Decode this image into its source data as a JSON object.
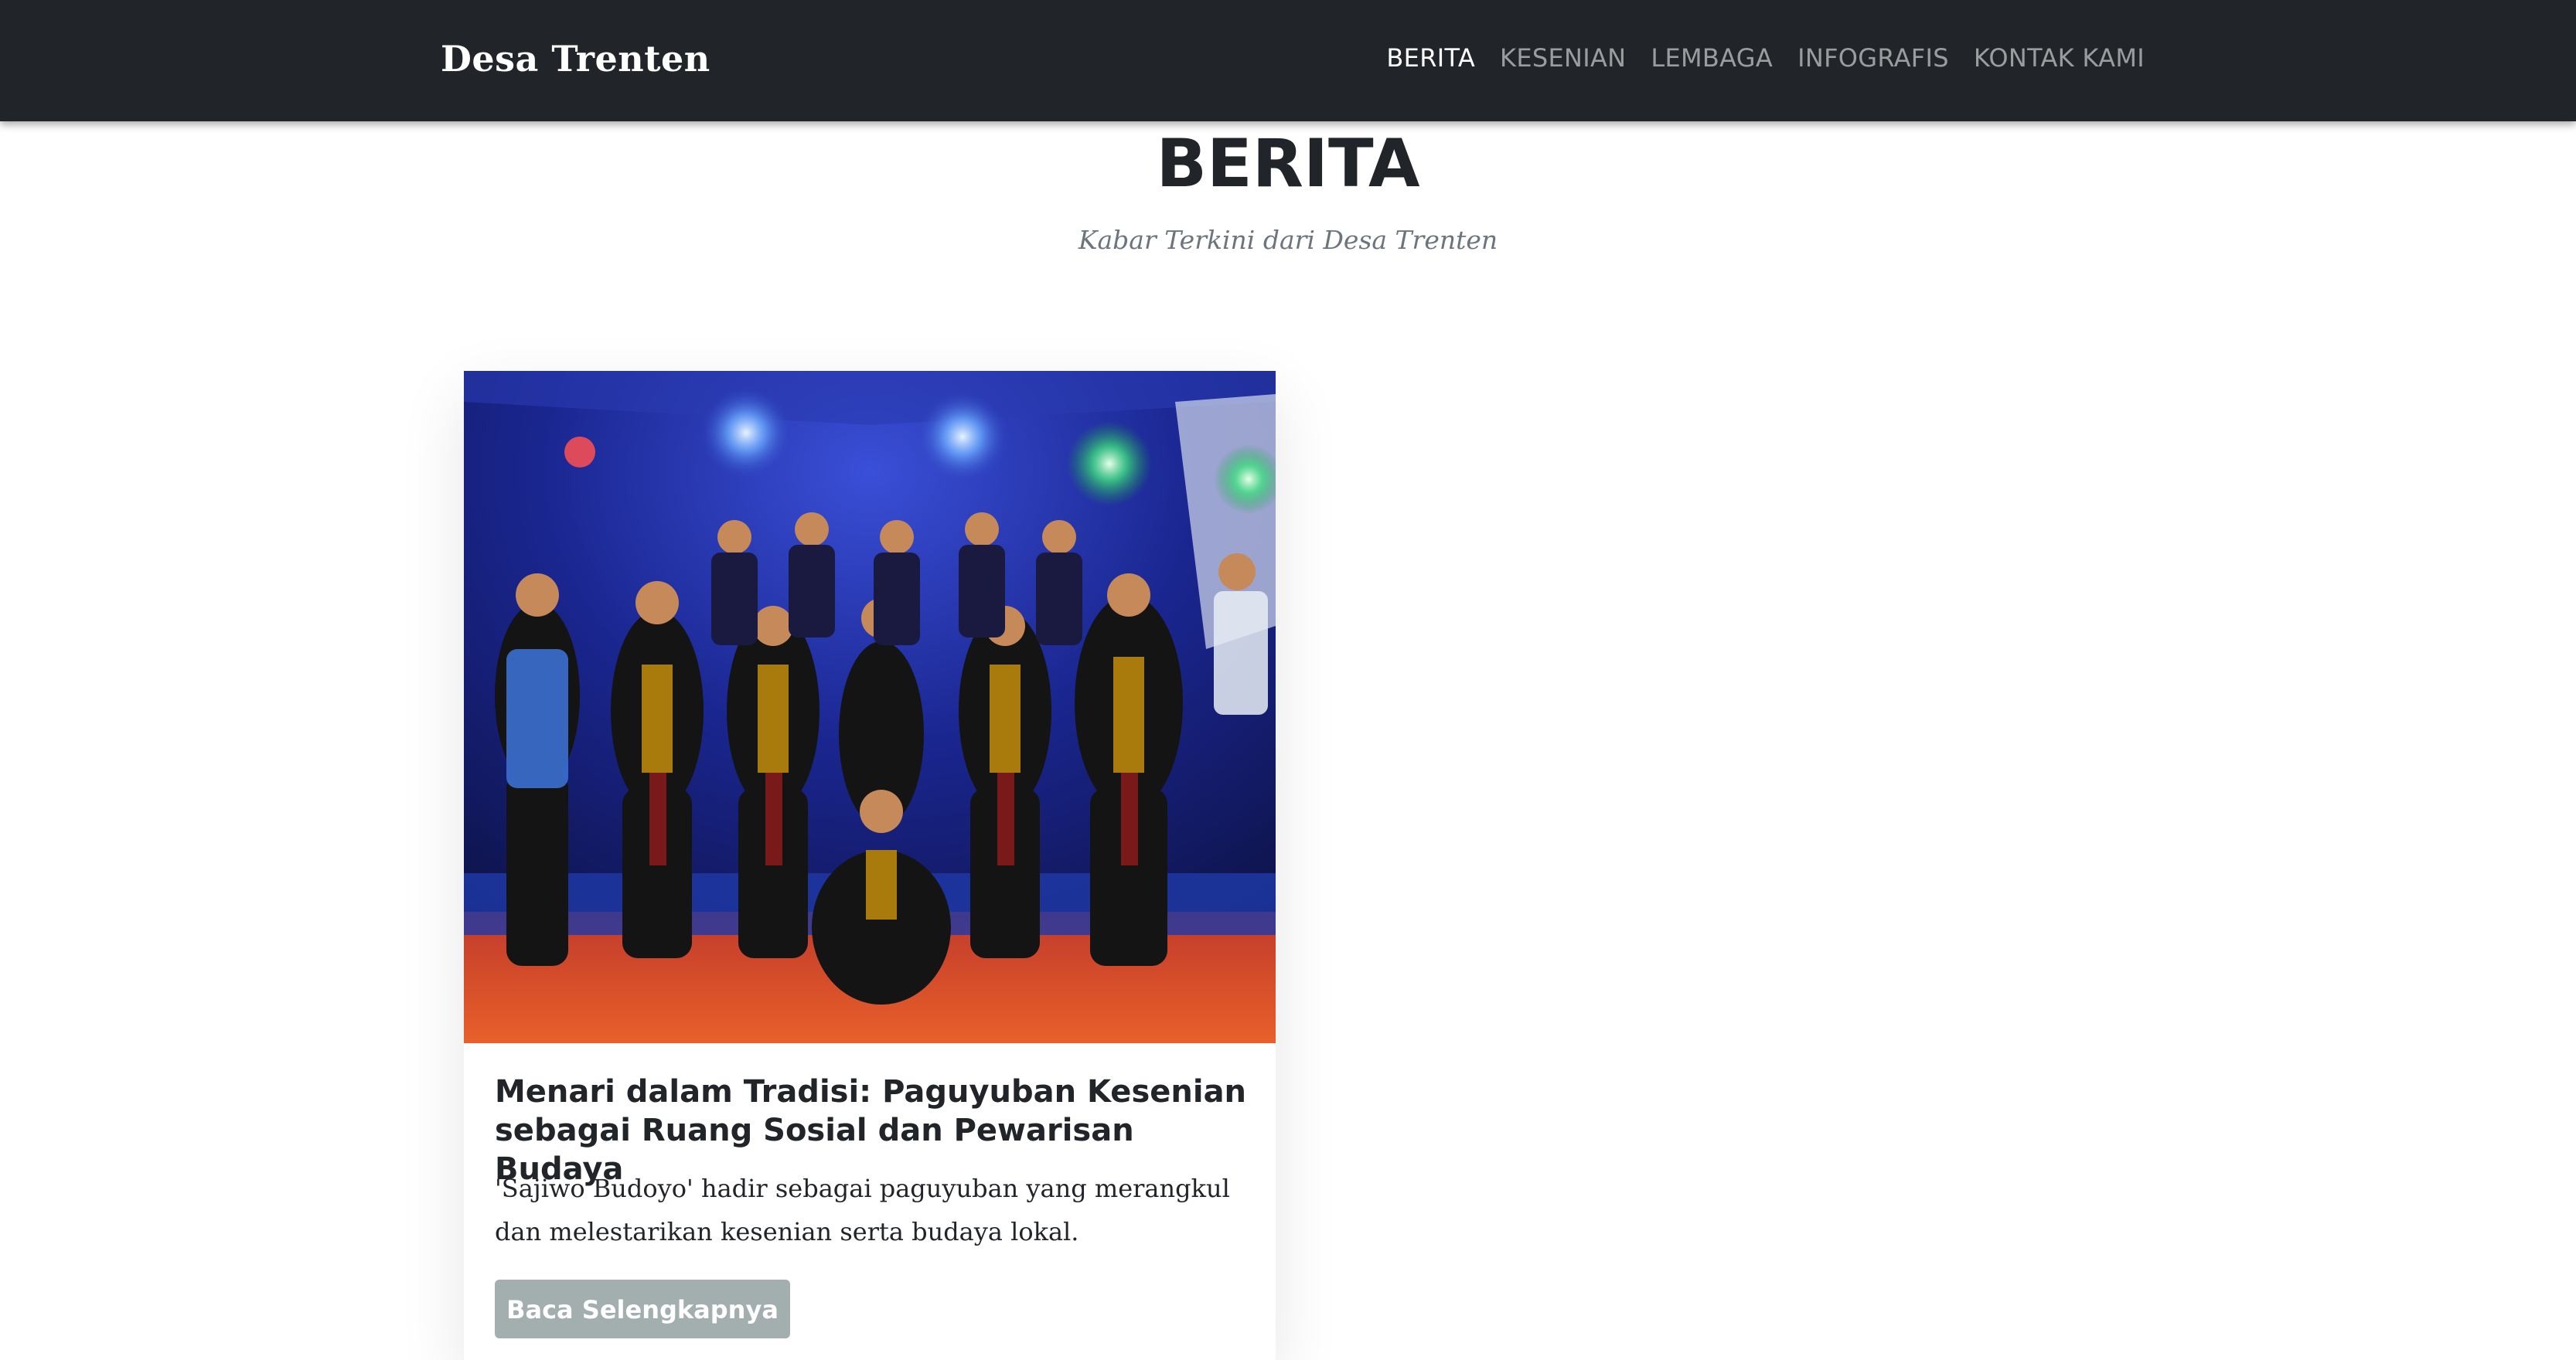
{
  "navbar": {
    "brand": "Desa Trenten",
    "items": [
      {
        "label": "BERITA",
        "active": true
      },
      {
        "label": "KESENIAN",
        "active": false
      },
      {
        "label": "LEMBAGA",
        "active": false
      },
      {
        "label": "INFOGRAFIS",
        "active": false
      },
      {
        "label": "KONTAK KAMI",
        "active": false
      }
    ]
  },
  "header": {
    "title": "BERITA",
    "subtitle": "Kabar Terkini dari Desa Trenten"
  },
  "articles": [
    {
      "image_description": "group-photo-dancers",
      "title": "Menari dalam Tradisi: Paguyuban Kesenian sebagai Ruang Sosial dan Pewarisan Budaya",
      "description": "'Sajiwo Budoyo' hadir sebagai paguyuban yang merangkul dan melestarikan kesenian serta budaya lokal.",
      "button_label": "Baca Selengkapnya"
    }
  ],
  "colors": {
    "navbar_bg": "#212529",
    "button_bg": "#a3aeaf",
    "title_text": "#212529",
    "subtitle_text": "#6c757d"
  }
}
